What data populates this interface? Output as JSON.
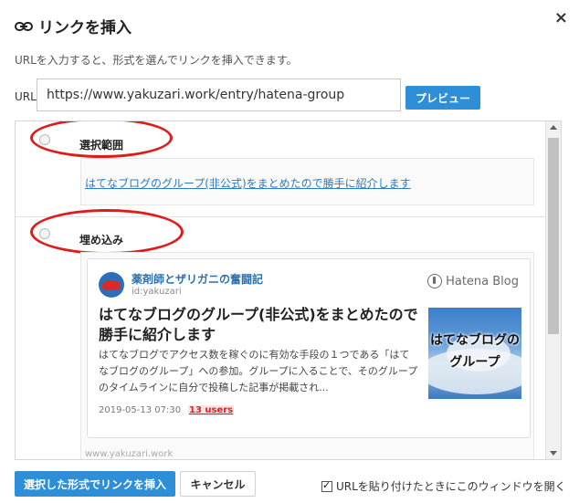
{
  "dialog": {
    "title": "リンクを挿入",
    "close_label": "×",
    "description": "URLを入力すると、形式を選んでリンクを挿入できます。"
  },
  "url": {
    "label": "URL",
    "value": "https://www.yakuzari.work/entry/hatena-group",
    "preview_label": "プレビュー"
  },
  "options": [
    {
      "label": "選択範囲",
      "link_text": "はてなブログのグループ(非公式)をまとめたので勝手に紹介します"
    },
    {
      "label": "埋め込み"
    }
  ],
  "embed_card": {
    "blog_name": "薬剤師とザリガニの奮闘記",
    "blog_id": "id:yakuzari",
    "brand": "Hatena Blog",
    "title": "はてなブログのグループ(非公式)をまとめたので勝手に紹介します",
    "description": "はてなブログでアクセス数を稼ぐのに有効な手段の１つである「はてなブログのグループ」への参加。グループに入ることで、そのグループのタイムラインに自分で投稿した記事が掲載され...",
    "date": "2019-05-13 07:30",
    "users": "13 users",
    "thumbnail_text": "はてなブログの グループ",
    "url": "www.yakuzari.work"
  },
  "footer": {
    "insert_label": "選択した形式でリンクを挿入",
    "cancel_label": "キャンセル",
    "checkbox_label": "URLを貼り付けたときにこのウィンドウを開く",
    "checkbox_checked": true
  },
  "colors": {
    "accent": "#2e8fd8",
    "annotation": "#e01b1b",
    "link": "#2a7bc4"
  }
}
